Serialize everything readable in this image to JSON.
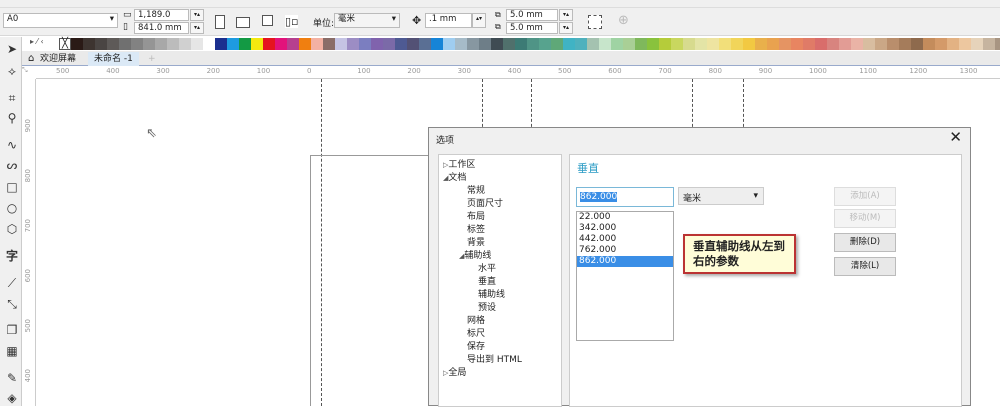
{
  "property_bar": {
    "page_size": "A0",
    "width": "1,189.0 mm",
    "height": "841.0 mm",
    "units_label": "单位:",
    "units_value": "毫米",
    "nudge": ".1 mm",
    "dup_x": "5.0 mm",
    "dup_y": "5.0 mm"
  },
  "palette": [
    "#2a1a16",
    "#3d3430",
    "#4a4543",
    "#5e5a58",
    "#707070",
    "#828282",
    "#959595",
    "#a8a8a8",
    "#bcbcbc",
    "#d0d0d0",
    "#e6e6e6",
    "#ffffff",
    "#1b2f8f",
    "#1e9be0",
    "#139a44",
    "#f4e90f",
    "#e5141f",
    "#e2137b",
    "#b6408f",
    "#f07f10",
    "#f3b1a2",
    "#8a6d68",
    "#c5c4e4",
    "#9c8dc4",
    "#7b7ec0",
    "#8063ad",
    "#7b6aa8",
    "#4e5a93",
    "#535175",
    "#5a6f94",
    "#1684d7",
    "#9fcdf0",
    "#a6bbc8",
    "#8797a1",
    "#6e7e88",
    "#3f4b53",
    "#50706c",
    "#3c7b75",
    "#4f9486",
    "#57a38e",
    "#5fa878",
    "#40b3c4",
    "#4fb1bd",
    "#a4c2b0",
    "#c7e5cb",
    "#9fd3a3",
    "#a9cf96",
    "#7fb85c",
    "#89c23d",
    "#b5cc3a",
    "#c9d75f",
    "#d7db8e",
    "#e3e4a6",
    "#eee4a1",
    "#f2df7a",
    "#f1d55a",
    "#f2c942",
    "#e9b04b",
    "#e9a24f",
    "#e59463",
    "#e88561",
    "#e07b67",
    "#d96d6b",
    "#d8847f",
    "#e29c95",
    "#eab3a6",
    "#d8bda0",
    "#caa786",
    "#b98e6c",
    "#a57c5b",
    "#8e6a4d",
    "#c48c5c",
    "#d49a69",
    "#e3b283",
    "#edc79f",
    "#e6d3ba",
    "#c6b49f",
    "#a89582",
    "#8b7a6b"
  ],
  "tabs": {
    "welcome": "欢迎屏幕",
    "document": "未命名 -1"
  },
  "ruler": {
    "h_labels": [
      "500",
      "400",
      "300",
      "200",
      "100",
      "0",
      "100",
      "200",
      "300",
      "400",
      "500",
      "600",
      "700",
      "800",
      "900",
      "1000",
      "1100",
      "1200",
      "1300"
    ],
    "v_labels": [
      "900",
      "800",
      "700",
      "600",
      "500",
      "400"
    ]
  },
  "dialog": {
    "title": "选项",
    "tree": [
      {
        "label": "工作区",
        "level": 0,
        "arrow": "▷"
      },
      {
        "label": "文档",
        "level": 0,
        "arrow": "◢"
      },
      {
        "label": "常规",
        "level": 1
      },
      {
        "label": "页面尺寸",
        "level": 1
      },
      {
        "label": "布局",
        "level": 1
      },
      {
        "label": "标签",
        "level": 1
      },
      {
        "label": "背景",
        "level": 1
      },
      {
        "label": "辅助线",
        "level": 1,
        "arrow": "◢"
      },
      {
        "label": "水平",
        "level": 2
      },
      {
        "label": "垂直",
        "level": 2
      },
      {
        "label": "辅助线",
        "level": 2
      },
      {
        "label": "预设",
        "level": 2
      },
      {
        "label": "网格",
        "level": 1
      },
      {
        "label": "标尺",
        "level": 1
      },
      {
        "label": "保存",
        "level": 1
      },
      {
        "label": "导出到 HTML",
        "level": 1
      },
      {
        "label": "全局",
        "level": 0,
        "arrow": "▷"
      }
    ],
    "panel_title": "垂直",
    "value_input": "862.000",
    "unit_select": "毫米",
    "guides_list": [
      "22.000",
      "342.000",
      "442.000",
      "762.000",
      "862.000"
    ],
    "selected_guide": "862.000",
    "buttons": {
      "add": "添加(A)",
      "move": "移动(M)",
      "delete": "删除(D)",
      "clear": "清除(L)"
    },
    "annotation": "垂直辅助线从左到右的参数"
  }
}
